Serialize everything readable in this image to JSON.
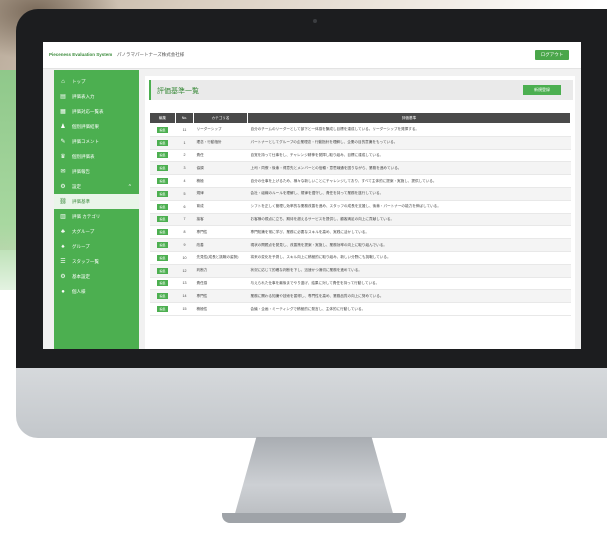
{
  "app": {
    "brand": "Pieceness Evaluation System",
    "company": "パノラマパートナーズ株式会社様",
    "logout_label": "ログアウト"
  },
  "sidebar": {
    "items": [
      {
        "label": "トップ",
        "icon": "home-icon",
        "glyph": "⌂"
      },
      {
        "label": "評価表入力",
        "icon": "form-icon",
        "glyph": "▤"
      },
      {
        "label": "評価対応一覧表",
        "icon": "list-icon",
        "glyph": "▦"
      },
      {
        "label": "個別評価結果",
        "icon": "person-icon",
        "glyph": "♟"
      },
      {
        "label": "評価コメント",
        "icon": "comment-icon",
        "glyph": "✎"
      },
      {
        "label": "個別評価表",
        "icon": "trophy-icon",
        "glyph": "♛"
      },
      {
        "label": "評価報告",
        "icon": "mail-icon",
        "glyph": "✉"
      },
      {
        "label": "設定",
        "icon": "gear-icon",
        "glyph": "⚙"
      },
      {
        "label": "評価基準",
        "icon": "link-icon",
        "glyph": "⛓"
      },
      {
        "label": "評価 カテゴリ",
        "icon": "chart-icon",
        "glyph": "▥"
      },
      {
        "label": "大グループ",
        "icon": "group-icon",
        "glyph": "♣"
      },
      {
        "label": "グループ",
        "icon": "group-small-icon",
        "glyph": "♠"
      },
      {
        "label": "スタッフ一覧",
        "icon": "staff-icon",
        "glyph": "☰"
      },
      {
        "label": "基本設定",
        "icon": "settings-icon",
        "glyph": "⚙"
      },
      {
        "label": "個人様",
        "icon": "chat-icon",
        "glyph": "●"
      }
    ]
  },
  "page": {
    "title": "評価基準一覧",
    "new_button": "新規登録"
  },
  "table": {
    "headers": [
      "編集",
      "No.",
      "カテゴリ名",
      "評価基準"
    ],
    "edit_label": "編集",
    "rows": [
      {
        "no": "11",
        "category": "リーダーシップ",
        "criteria": "自分のチームのリーダーとして部下と一体感を醸成し目標を達成している。リーダーシップを発揮する。"
      },
      {
        "no": "1",
        "category": "理念・行動指針",
        "criteria": "パートナーとしてグループの企業理念・行動指針を理解し、企業の目的意識をもっている。"
      },
      {
        "no": "2",
        "category": "責任",
        "criteria": "自覚を持って仕事をし、チャレンジ精神を発揮し取り組み、目標に達成している。"
      },
      {
        "no": "3",
        "category": "協調",
        "criteria": "上司・同僚・後輩・得意先とメンバーとの信頼・意思疎通を図りながら、業務を進めている。"
      },
      {
        "no": "4",
        "category": "積極",
        "criteria": "自分の仕事を上げるため、様々な新しいことにチャレンジしており、すべて主体的に提案・実施し、提供している。"
      },
      {
        "no": "5",
        "category": "規律",
        "criteria": "会社・組織のルールを理解し、規律を遵守し、責任を持って業務を遂行している。"
      },
      {
        "no": "6",
        "category": "育成",
        "criteria": "シフトを正しく管理し効率的な業務改善を進め、スタッフの成長を支援し、後輩・パートナーの能力を伸ばしている。"
      },
      {
        "no": "7",
        "category": "接客",
        "criteria": "お客様の視点に立ち、期待を超えるサービスを提供し、顧客満足の向上に貢献している。"
      },
      {
        "no": "8",
        "category": "専門性",
        "criteria": "専門知識を常に学び、業務に必要なスキルを高め、実践に活かしている。"
      },
      {
        "no": "9",
        "category": "改善",
        "criteria": "現状の問題点を発見し、改善策を提案・実施し、業務効率の向上に取り組んでいる。"
      },
      {
        "no": "10",
        "category": "先見性(成長と挑戦の姿勢)",
        "criteria": "将来の変化を予測し、スキル向上に積極的に取り組み、新しい分野にも挑戦している。"
      },
      {
        "no": "12",
        "category": "判断力",
        "criteria": "状況に応じて的確な判断を下し、迅速かつ適切に業務を進めている。"
      },
      {
        "no": "13",
        "category": "責任感",
        "criteria": "与えられた仕事を最後までやり遂げ、結果に対して責任を持って行動している。"
      },
      {
        "no": "14",
        "category": "専門性",
        "criteria": "業務に関わる知識や技術を習得し、専門性を高め、業務品質の向上に努めている。"
      },
      {
        "no": "15",
        "category": "積極性",
        "criteria": "会議・企画・ミーティングで積極的に発言し、主体的に行動している。"
      }
    ]
  }
}
